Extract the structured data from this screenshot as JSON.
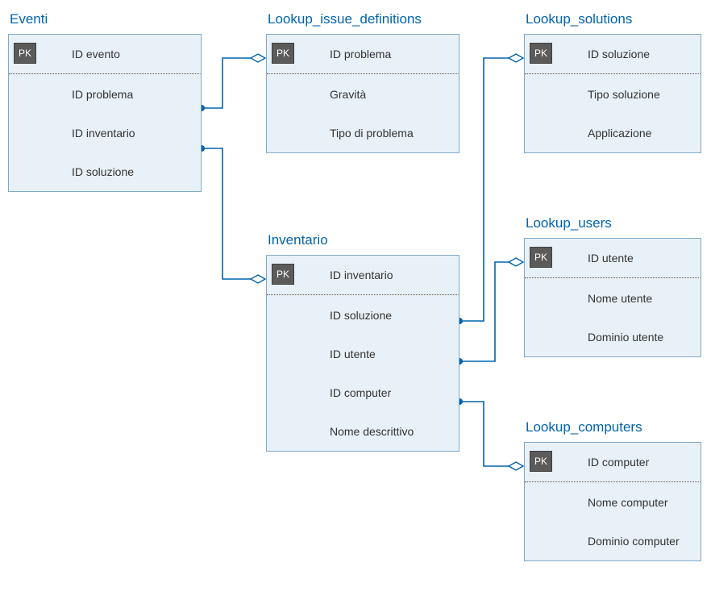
{
  "tables": {
    "eventi": {
      "title": "Eventi",
      "pk_label": "PK",
      "fields": [
        "ID evento",
        "ID problema",
        "ID inventario",
        "ID soluzione"
      ]
    },
    "issue_defs": {
      "title": "Lookup_issue_definitions",
      "pk_label": "PK",
      "fields": [
        "ID problema",
        "Gravità",
        "Tipo di problema"
      ]
    },
    "solutions": {
      "title": "Lookup_solutions",
      "pk_label": "PK",
      "fields": [
        "ID soluzione",
        "Tipo soluzione",
        "Applicazione"
      ]
    },
    "inventario": {
      "title": "Inventario",
      "pk_label": "PK",
      "fields": [
        "ID inventario",
        "ID soluzione",
        "ID utente",
        "ID computer",
        "Nome descrittivo"
      ]
    },
    "users": {
      "title": "Lookup_users",
      "pk_label": "PK",
      "fields": [
        "ID utente",
        "Nome utente",
        "Dominio utente"
      ]
    },
    "computers": {
      "title": "Lookup_computers",
      "pk_label": "PK",
      "fields": [
        "ID computer",
        "Nome computer",
        "Dominio computer"
      ]
    }
  }
}
